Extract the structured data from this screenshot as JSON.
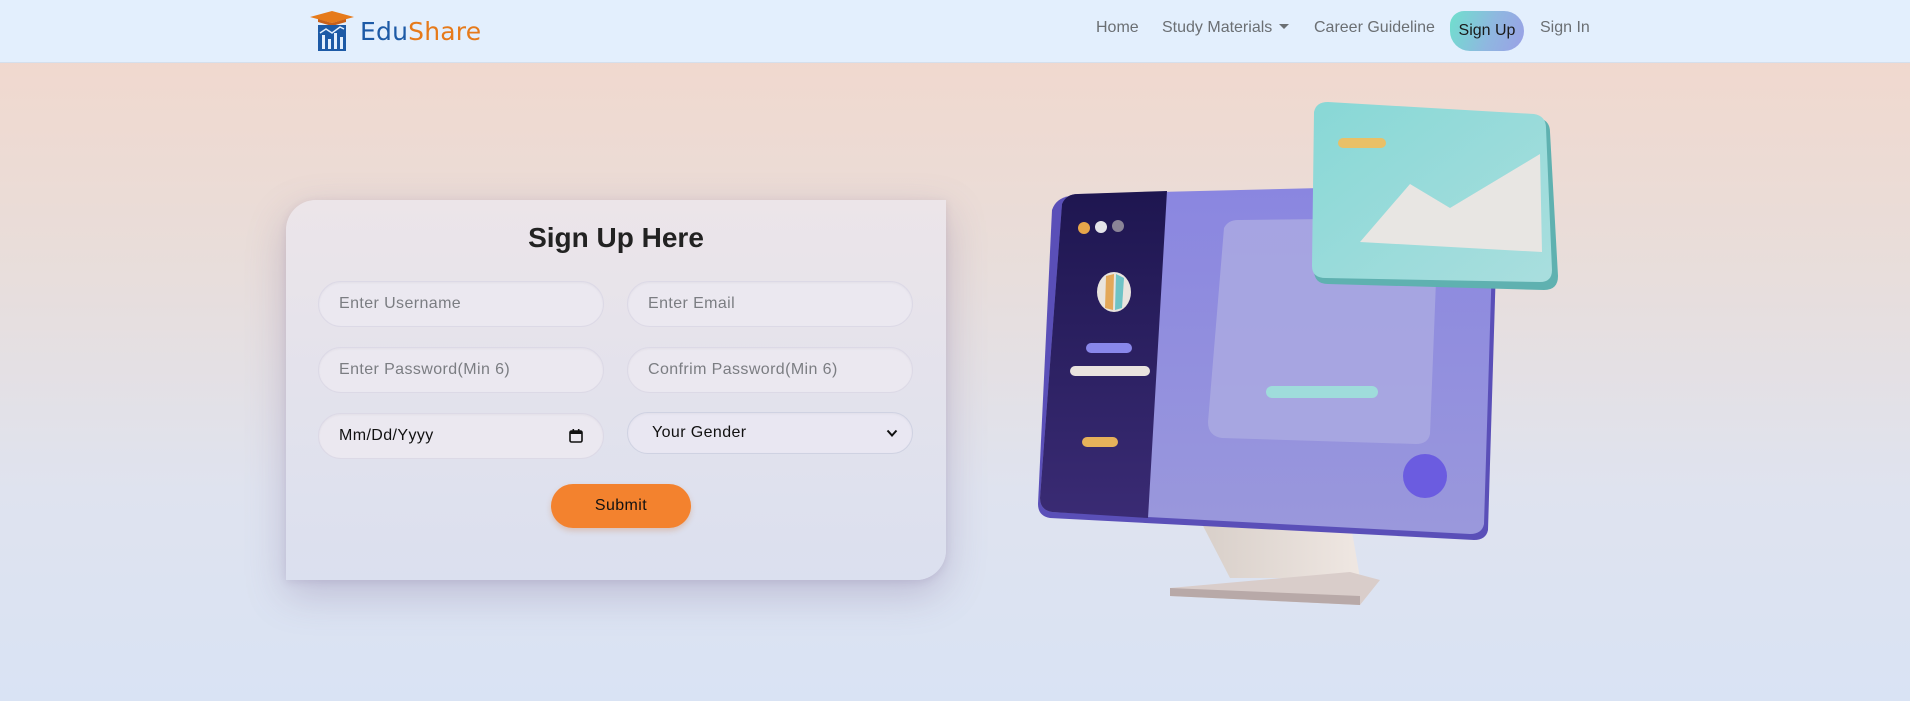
{
  "brand": {
    "part1": "Edu",
    "part2": "Share"
  },
  "nav": {
    "home": "Home",
    "study_materials": "Study Materials",
    "career": "Career Guideline",
    "signup": "Sign Up",
    "signin": "Sign In"
  },
  "form": {
    "title": "Sign Up Here",
    "username_placeholder": "Enter Username",
    "email_placeholder": "Enter Email",
    "password_placeholder": "Enter Password(Min 6)",
    "confirm_placeholder": "Confrim Password(Min 6)",
    "date_value": "Mm/Dd/Yyyy",
    "gender_selected": "Your Gender",
    "submit_label": "Submit"
  },
  "colors": {
    "nav_bg": "#e3effd",
    "accent_orange": "#f3822e",
    "brand_blue": "#1d5aa6",
    "brand_orange": "#e67a1a"
  }
}
